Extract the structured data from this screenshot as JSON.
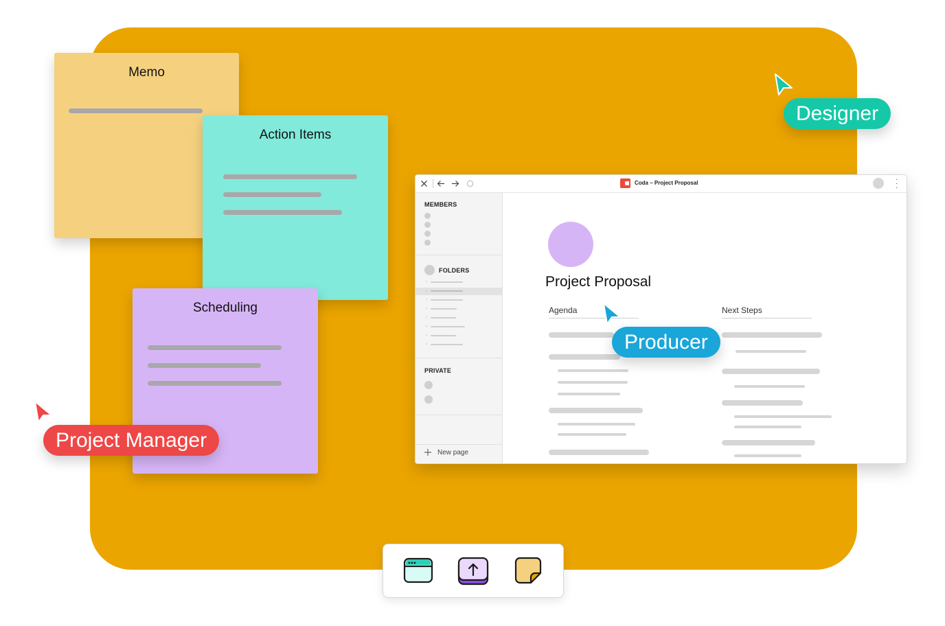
{
  "notes": {
    "memo": {
      "title": "Memo",
      "color": "#f5d17f"
    },
    "action_items": {
      "title": "Action Items",
      "color": "#81eadb"
    },
    "scheduling": {
      "title": "Scheduling",
      "color": "#d6b5f6"
    }
  },
  "window": {
    "title": "Coda – Project Proposal",
    "sidebar": {
      "members_label": "MEMBERS",
      "folders_label": "FOLDERS",
      "private_label": "PRIVATE",
      "new_page_label": "New page"
    },
    "doc": {
      "title": "Project Proposal",
      "col1_header": "Agenda",
      "col2_header": "Next Steps"
    }
  },
  "cursors": {
    "designer": {
      "label": "Designer",
      "color": "#15c8a8"
    },
    "producer": {
      "label": "Producer",
      "color": "#1aa6d8"
    },
    "project_manager": {
      "label": "Project Manager",
      "color": "#ee4747"
    }
  },
  "toolbar": {
    "tools": [
      {
        "icon": "browser-window-icon"
      },
      {
        "icon": "upload-icon"
      },
      {
        "icon": "sticky-note-icon"
      }
    ]
  },
  "colors": {
    "board": "#eba500"
  }
}
